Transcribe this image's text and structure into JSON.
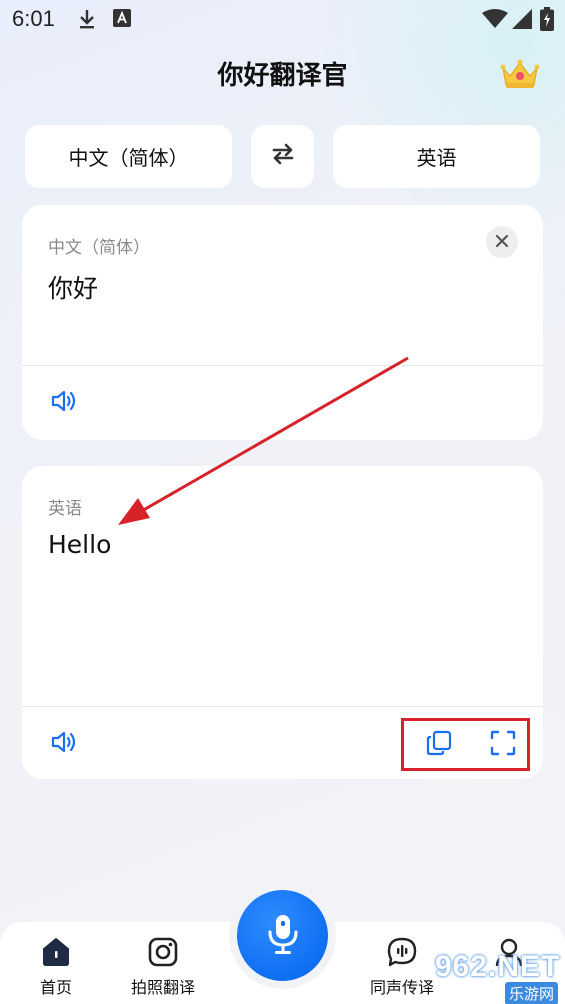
{
  "status_bar": {
    "time": "6:01"
  },
  "header": {
    "title": "你好翻译官",
    "vip_icon": "crown-icon"
  },
  "language_bar": {
    "source": "中文（简体）",
    "swap_icon": "swap-icon",
    "target": "英语"
  },
  "source_card": {
    "language": "中文（简体）",
    "text": "你好",
    "clear_icon": "close-icon",
    "speak_icon": "speaker-icon"
  },
  "target_card": {
    "language": "英语",
    "text": "Hello",
    "speak_icon": "speaker-icon",
    "copy_icon": "copy-icon",
    "fullscreen_icon": "fullscreen-icon"
  },
  "bottom_nav": {
    "items": [
      {
        "label": "首页",
        "icon": "home-icon"
      },
      {
        "label": "拍照翻译",
        "icon": "camera-icon"
      },
      {
        "label": "同声传译",
        "icon": "voice-chat-icon"
      },
      {
        "label": "",
        "icon": "profile-icon"
      }
    ],
    "mic_icon": "microphone-icon"
  },
  "watermark": {
    "text": "962.NET",
    "sub": "乐游网"
  },
  "colors": {
    "accent": "#1a6ff0",
    "annotation": "#d8222a",
    "card_bg": "#ffffff",
    "page_bg": "#f1f2f7"
  }
}
